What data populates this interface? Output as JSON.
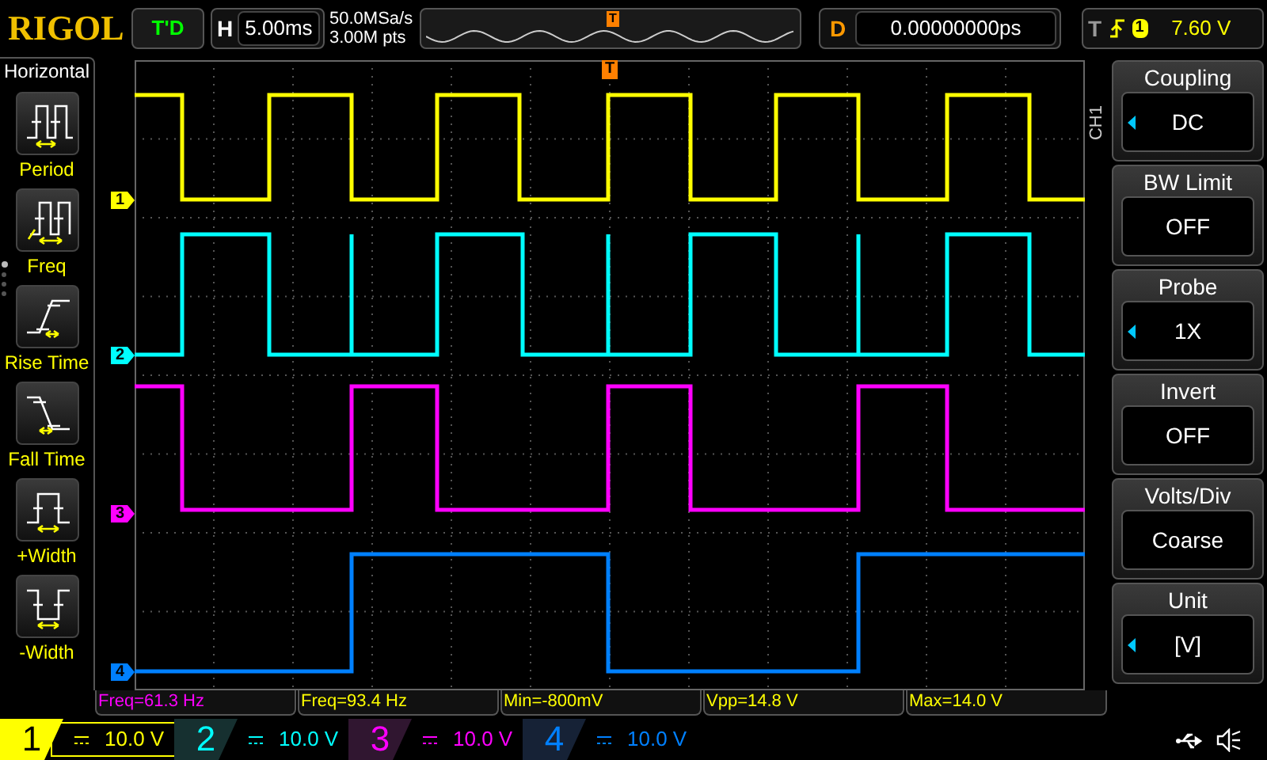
{
  "top_bar": {
    "logo": "RIGOL",
    "run_status": "T'D",
    "horizontal": {
      "label": "H",
      "timebase": "5.00ms"
    },
    "sample_rate": "50.0MSa/s",
    "memory_depth": "3.00M pts",
    "delay": {
      "label": "D",
      "value": "0.00000000ps"
    },
    "trigger": {
      "label": "T",
      "source": "1",
      "level": "7.60 V"
    }
  },
  "left_menu": {
    "title": "Horizontal",
    "items": [
      {
        "kind": "period",
        "label": "Period"
      },
      {
        "kind": "freq",
        "label": "Freq"
      },
      {
        "kind": "rise",
        "label": "Rise Time"
      },
      {
        "kind": "fall",
        "label": "Fall Time"
      },
      {
        "kind": "pwidth",
        "label": "+Width"
      },
      {
        "kind": "nwidth",
        "label": "-Width"
      }
    ]
  },
  "trace_markers": [
    {
      "label": "1",
      "color": "#ffff00"
    },
    {
      "label": "2",
      "color": "#00ffff"
    },
    {
      "label": "3",
      "color": "#ff00ff"
    },
    {
      "label": "4",
      "color": "#0080ff"
    }
  ],
  "trigger_marker": "T",
  "overview_trigger_marker": "T",
  "right_menu": {
    "channel": "CH1",
    "items": [
      {
        "title": "Coupling",
        "value": "DC",
        "adjustable": true
      },
      {
        "title": "BW Limit",
        "value": "OFF",
        "adjustable": false
      },
      {
        "title": "Probe",
        "value": "1X",
        "adjustable": true
      },
      {
        "title": "Invert",
        "value": "OFF",
        "adjustable": false
      },
      {
        "title": "Volts/Div",
        "value": "Coarse",
        "adjustable": false
      },
      {
        "title": "Unit",
        "value": "[V]",
        "adjustable": true
      }
    ]
  },
  "measurements": [
    {
      "text": "Freq=61.3 Hz",
      "color": "#ff00ff"
    },
    {
      "text": "Freq=93.4 Hz",
      "color": "#ffff00"
    },
    {
      "text": "Min=-800mV",
      "color": "#ffff00"
    },
    {
      "text": "Vpp=14.8 V",
      "color": "#ffff00"
    },
    {
      "text": "Max=14.0 V",
      "color": "#ffff00"
    }
  ],
  "channels": [
    {
      "number": "1",
      "scale": "10.0 V",
      "color": "#ffff00",
      "selected": true
    },
    {
      "number": "2",
      "scale": "10.0 V",
      "color": "#00ffff",
      "selected": false
    },
    {
      "number": "3",
      "scale": "10.0 V",
      "color": "#ff00ff",
      "selected": false
    },
    {
      "number": "4",
      "scale": "10.0 V",
      "color": "#0080ff",
      "selected": false
    }
  ]
}
